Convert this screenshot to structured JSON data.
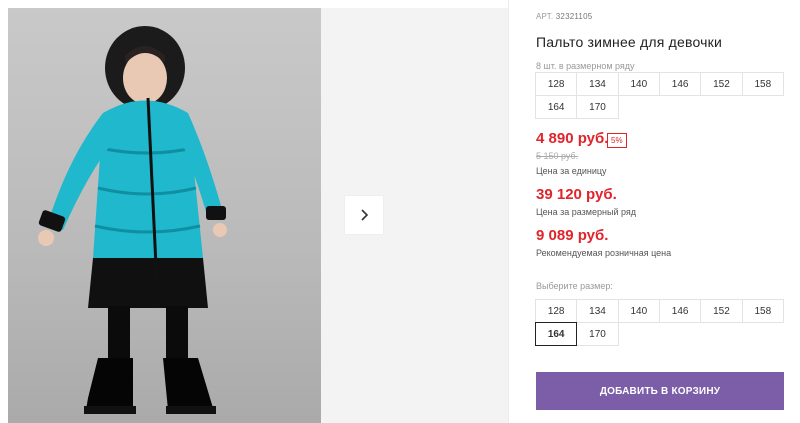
{
  "product": {
    "article_label": "АРТ.",
    "article_number": "32321105",
    "title": "Пальто зимнее для девочки"
  },
  "set_info": {
    "label": "8 шт. в размерном ряду",
    "sizes": [
      "128",
      "134",
      "140",
      "146",
      "152",
      "158",
      "164",
      "170"
    ]
  },
  "prices": {
    "unit_price": "4 890 руб.",
    "discount_badge": "5%",
    "old_price": "5 150 руб.",
    "unit_note": "Цена за единицу",
    "set_price": "39 120 руб.",
    "set_note": "Цена за размерный ряд",
    "retail_price": "9 089 руб.",
    "retail_note": "Рекомендуемая розничная цена"
  },
  "size_picker": {
    "label": "Выберите размер:",
    "sizes": [
      "128",
      "134",
      "140",
      "146",
      "152",
      "158",
      "164",
      "170"
    ],
    "selected": "164"
  },
  "actions": {
    "add_to_cart": "ДОБАВИТЬ В КОРЗИНУ"
  },
  "colors": {
    "accent": "#7b5ea7",
    "price_red": "#e0242b",
    "coat_blue": "#19b6c9"
  },
  "icons": {
    "gallery_next": "chevron-right-icon"
  }
}
